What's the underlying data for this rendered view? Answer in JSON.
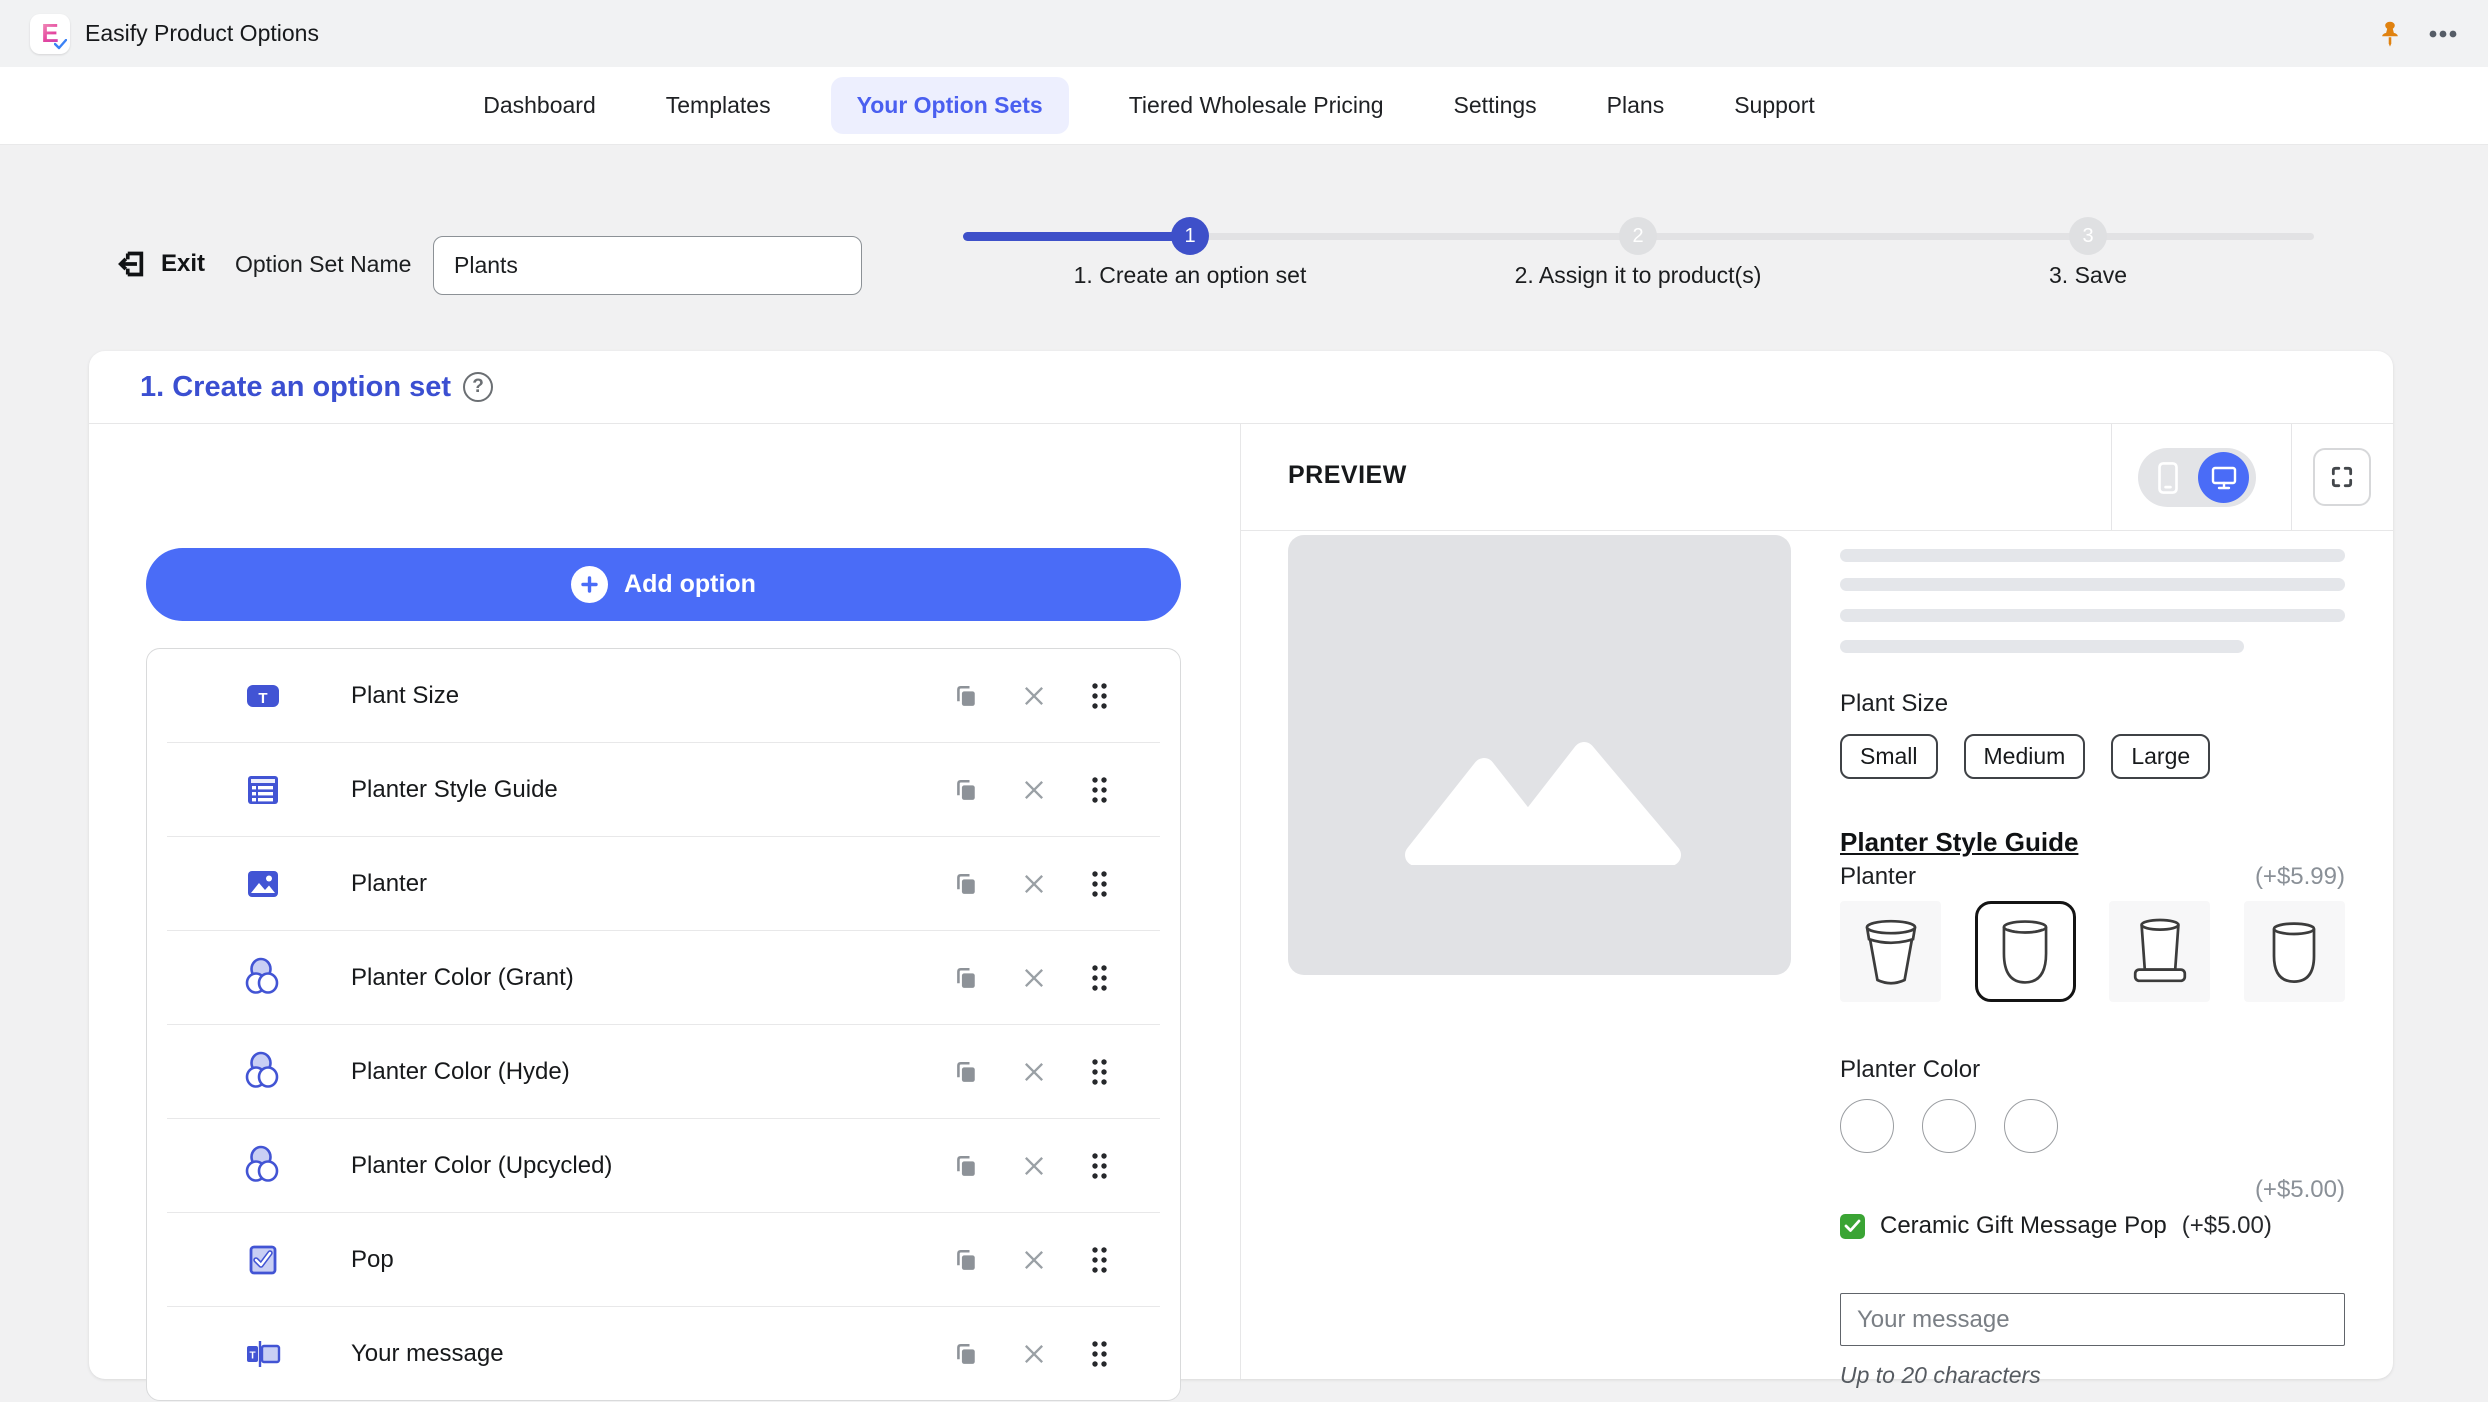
{
  "topbar": {
    "logo_letter": "E",
    "app_title": "Easify Product Options"
  },
  "nav": {
    "items": [
      {
        "label": "Dashboard"
      },
      {
        "label": "Templates"
      },
      {
        "label": "Your Option Sets"
      },
      {
        "label": "Tiered Wholesale Pricing"
      },
      {
        "label": "Settings"
      },
      {
        "label": "Plans"
      },
      {
        "label": "Support"
      }
    ],
    "active_index": 2
  },
  "toolbar": {
    "exit_label": "Exit",
    "option_set_name_label": "Option Set Name",
    "option_set_name_value": "Plants"
  },
  "stepper": {
    "steps": [
      {
        "number": "1",
        "label": "1. Create an option set",
        "active": true
      },
      {
        "number": "2",
        "label": "2. Assign it to product(s)",
        "active": false
      },
      {
        "number": "3",
        "label": "3. Save",
        "active": false
      }
    ]
  },
  "card": {
    "title": "1. Create an option set",
    "help_glyph": "?"
  },
  "options_panel": {
    "add_option_label": "Add option",
    "options": [
      {
        "label": "Plant Size",
        "icon": "button-swatch-icon"
      },
      {
        "label": "Planter Style Guide",
        "icon": "list-icon"
      },
      {
        "label": "Planter",
        "icon": "image-icon"
      },
      {
        "label": "Planter Color (Grant)",
        "icon": "color-swatch-icon"
      },
      {
        "label": "Planter Color (Hyde)",
        "icon": "color-swatch-icon"
      },
      {
        "label": "Planter Color (Upcycled)",
        "icon": "color-swatch-icon"
      },
      {
        "label": "Pop",
        "icon": "checkbox-icon"
      },
      {
        "label": "Your message",
        "icon": "text-field-icon"
      }
    ]
  },
  "preview": {
    "title": "PREVIEW",
    "plant_size": {
      "label": "Plant Size",
      "choices": [
        "Small",
        "Medium",
        "Large"
      ]
    },
    "style_guide_link": "Planter Style Guide",
    "planter": {
      "label": "Planter",
      "price_note": "(+$5.99)",
      "selected_index": 1
    },
    "planter_color": {
      "label": "Planter Color",
      "swatches": [
        "#2e2c2b",
        "#e8e0d3",
        "#c17c57"
      ],
      "price_note": "(+$5.00)"
    },
    "gift_message": {
      "label": "Ceramic Gift Message Pop",
      "price_note": "(+$5.00)",
      "checked": true
    },
    "message_field": {
      "placeholder": "Your message",
      "helper": "Up to 20 characters"
    }
  },
  "colors": {
    "accent_blue": "#4a6cf7",
    "indigo_blue": "#3e50c9",
    "title_blue": "#3b4fd1",
    "option_icon_blue": "#4254d4",
    "pin_orange": "#e0820f",
    "check_green": "#3aa434",
    "page_bg": "#f1f1f2"
  }
}
